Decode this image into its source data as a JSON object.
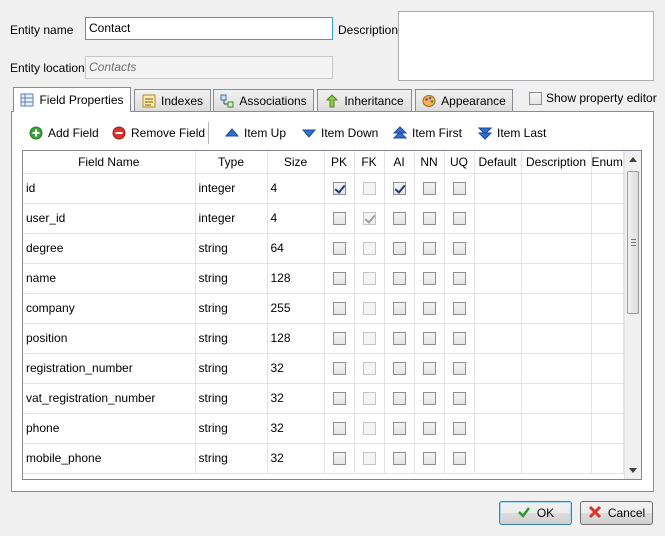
{
  "form": {
    "entity_name_label": "Entity name",
    "entity_name_value": "Contact",
    "description_label": "Description",
    "description_value": "",
    "entity_location_label": "Entity location",
    "entity_location_value": "Contacts"
  },
  "tabs": [
    {
      "label": "Field Properties",
      "icon": "grid-icon",
      "active": true
    },
    {
      "label": "Indexes",
      "icon": "index-icon",
      "active": false
    },
    {
      "label": "Associations",
      "icon": "associations-icon",
      "active": false
    },
    {
      "label": "Inheritance",
      "icon": "inheritance-arrow-icon",
      "active": false
    },
    {
      "label": "Appearance",
      "icon": "palette-icon",
      "active": false
    }
  ],
  "show_property_editor": {
    "label": "Show property editor",
    "checked": false
  },
  "toolbar": {
    "add_field": "Add Field",
    "remove_field": "Remove Field",
    "item_up": "Item Up",
    "item_down": "Item Down",
    "item_first": "Item First",
    "item_last": "Item Last"
  },
  "table": {
    "columns": [
      "Field Name",
      "Type",
      "Size",
      "PK",
      "FK",
      "AI",
      "NN",
      "UQ",
      "Default",
      "Description",
      "Enum"
    ],
    "rows": [
      {
        "name": "id",
        "type": "integer",
        "size": "4",
        "pk": true,
        "fk": false,
        "ai": true,
        "nn": false,
        "uq": false
      },
      {
        "name": "user_id",
        "type": "integer",
        "size": "4",
        "pk": false,
        "fk": true,
        "ai": false,
        "nn": false,
        "uq": false
      },
      {
        "name": "degree",
        "type": "string",
        "size": "64",
        "pk": false,
        "fk": false,
        "ai": false,
        "nn": false,
        "uq": false
      },
      {
        "name": "name",
        "type": "string",
        "size": "128",
        "pk": false,
        "fk": false,
        "ai": false,
        "nn": false,
        "uq": false
      },
      {
        "name": "company",
        "type": "string",
        "size": "255",
        "pk": false,
        "fk": false,
        "ai": false,
        "nn": false,
        "uq": false
      },
      {
        "name": "position",
        "type": "string",
        "size": "128",
        "pk": false,
        "fk": false,
        "ai": false,
        "nn": false,
        "uq": false
      },
      {
        "name": "registration_number",
        "type": "string",
        "size": "32",
        "pk": false,
        "fk": false,
        "ai": false,
        "nn": false,
        "uq": false
      },
      {
        "name": "vat_registration_number",
        "type": "string",
        "size": "32",
        "pk": false,
        "fk": false,
        "ai": false,
        "nn": false,
        "uq": false
      },
      {
        "name": "phone",
        "type": "string",
        "size": "32",
        "pk": false,
        "fk": false,
        "ai": false,
        "nn": false,
        "uq": false
      },
      {
        "name": "mobile_phone",
        "type": "string",
        "size": "32",
        "pk": false,
        "fk": false,
        "ai": false,
        "nn": false,
        "uq": false
      }
    ]
  },
  "buttons": {
    "ok": "OK",
    "cancel": "Cancel"
  },
  "colors": {
    "add_green": "#3aa43a",
    "remove_red": "#d9342b",
    "arrow_blue": "#2f6fd0",
    "focus_border": "#3399ff"
  }
}
